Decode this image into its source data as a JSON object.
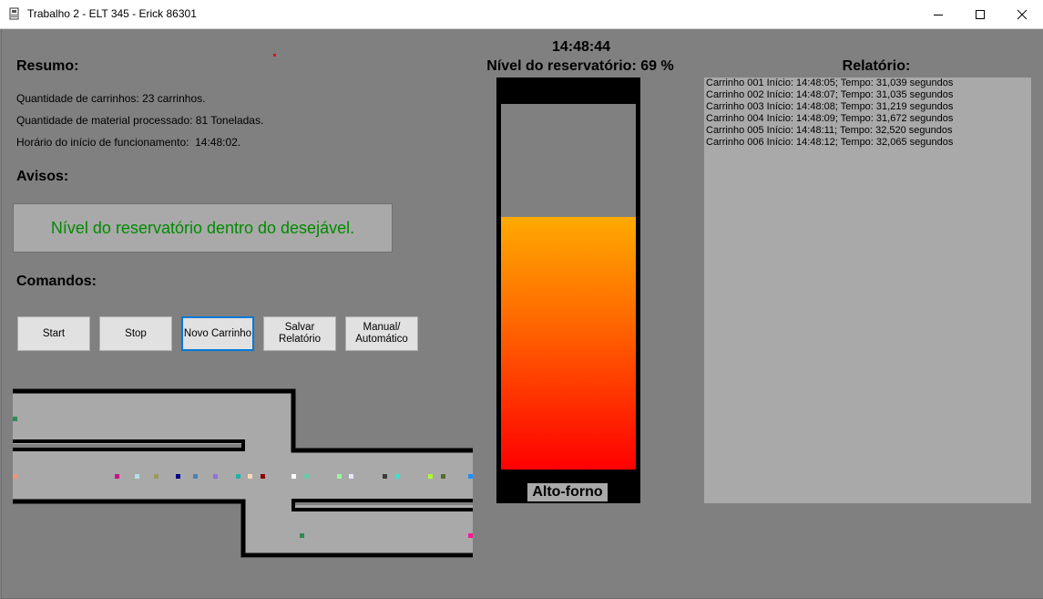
{
  "window": {
    "title": "Trabalho 2 - ELT 345 - Erick 86301"
  },
  "icons": {
    "app": "app-icon",
    "minimize": "minimize-icon",
    "maximize": "maximize-icon",
    "close": "close-icon"
  },
  "resumo": {
    "heading": "Resumo:",
    "carrinhos": "Quantidade de carrinhos: 23 carrinhos.",
    "material": "Quantidade de material processado: 81 Toneladas.",
    "inicio": "Horário do início de funcionamento:  14:48:02."
  },
  "avisos": {
    "heading": "Avisos:",
    "message": "Nível do reservatório dentro do desejável."
  },
  "comandos": {
    "heading": "Comandos:",
    "start": "Start",
    "stop": "Stop",
    "novo_carrinho": "Novo Carrinho",
    "salvar_relatorio": "Salvar\nRelatório",
    "manual_automatico": "Manual/\nAutomático"
  },
  "reservatorio": {
    "clock": "14:48:44",
    "nivel_label": "Nível do reservatório: 69 %",
    "level_fraction": 0.69,
    "furnace_label": "Alto-forno"
  },
  "relatorio": {
    "heading": "Relatório:",
    "lines": [
      "Carrinho 001 Início: 14:48:05; Tempo: 31,039 segundos",
      "Carrinho 002 Início: 14:48:07; Tempo: 31,035 segundos",
      "Carrinho 003 Início: 14:48:08; Tempo: 31,219 segundos",
      "Carrinho 004 Início: 14:48:09; Tempo: 31,672 segundos",
      "Carrinho 005 Início: 14:48:11; Tempo: 32,520 segundos",
      "Carrinho 006 Início: 14:48:12; Tempo: 32,065 segundos"
    ]
  },
  "colors": {
    "background": "#808080",
    "panel": "#a9a9a9",
    "aviso_text": "#008a00",
    "focus_border": "#0078d7"
  }
}
